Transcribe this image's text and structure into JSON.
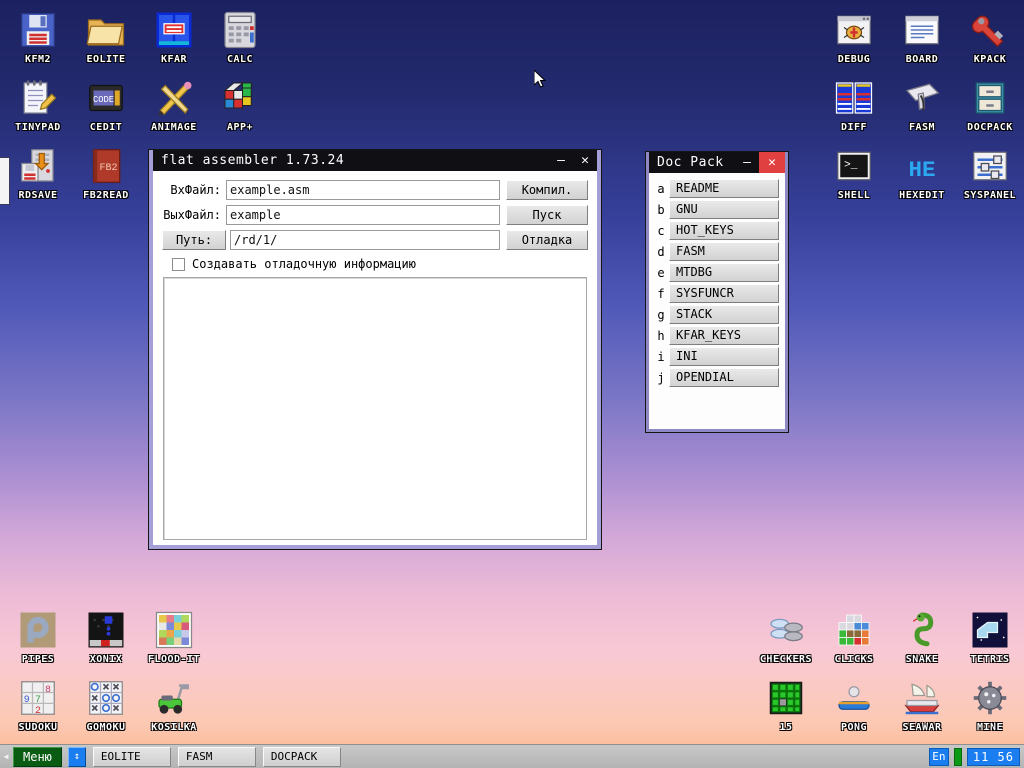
{
  "desktop": {
    "background_top": "#1b2160",
    "background_bottom": "#fbb489",
    "icons_top_left": [
      {
        "label": "KFM2",
        "icon": "floppy-disk-icon"
      },
      {
        "label": "EOLITE",
        "icon": "folder-icon"
      },
      {
        "label": "KFAR",
        "icon": "file-manager-icon"
      },
      {
        "label": "CALC",
        "icon": "calculator-icon"
      },
      {
        "label": "TINYPAD",
        "icon": "notepad-pencil-icon"
      },
      {
        "label": "CEDIT",
        "icon": "code-editor-icon"
      },
      {
        "label": "ANIMAGE",
        "icon": "pencil-brush-icon"
      },
      {
        "label": "APP+",
        "icon": "rubik-cube-icon"
      },
      {
        "label": "RDSAVE",
        "icon": "ramdisk-save-icon"
      },
      {
        "label": "FB2READ",
        "icon": "book-icon"
      }
    ],
    "icons_top_right": [
      {
        "label": "DEBUG",
        "icon": "bug-window-icon"
      },
      {
        "label": "BOARD",
        "icon": "text-window-icon"
      },
      {
        "label": "KPACK",
        "icon": "wrench-icon"
      },
      {
        "label": "DIFF",
        "icon": "diff-columns-icon"
      },
      {
        "label": "FASM",
        "icon": "assembler-hand-icon"
      },
      {
        "label": "DOCPACK",
        "icon": "cabinet-icon"
      },
      {
        "label": "SHELL",
        "icon": "terminal-icon"
      },
      {
        "label": "HEXEDIT",
        "icon": "hex-editor-icon"
      },
      {
        "label": "SYSPANEL",
        "icon": "sliders-icon"
      }
    ],
    "icons_bottom_left": [
      {
        "label": "PIPES",
        "icon": "pipes-icon"
      },
      {
        "label": "XONIX",
        "icon": "xonix-icon"
      },
      {
        "label": "FLOOD-IT",
        "icon": "flood-it-icon"
      },
      {
        "label": "SUDOKU",
        "icon": "sudoku-icon"
      },
      {
        "label": "GOMOKU",
        "icon": "gomoku-icon"
      },
      {
        "label": "KOSILKA",
        "icon": "lawnmower-icon"
      }
    ],
    "icons_bottom_right": [
      {
        "label": "CHECKERS",
        "icon": "checkers-icon"
      },
      {
        "label": "CLICKS",
        "icon": "blocks-icon"
      },
      {
        "label": "SNAKE",
        "icon": "snake-icon"
      },
      {
        "label": "TETRIS",
        "icon": "tetris-icon"
      },
      {
        "label": "15",
        "icon": "fifteen-puzzle-icon"
      },
      {
        "label": "PONG",
        "icon": "pong-icon"
      },
      {
        "label": "SEAWAR",
        "icon": "ship-icon"
      },
      {
        "label": "MINE",
        "icon": "mine-icon"
      }
    ]
  },
  "fasm_window": {
    "title": "flat assembler 1.73.24",
    "minimize_label": "–",
    "close_label": "✕",
    "input_file_label": "ВхФайл:",
    "input_file_value": "example.asm",
    "output_file_label": "ВыхФайл:",
    "output_file_value": "example",
    "path_button_label": "Путь:",
    "path_value": "/rd/1/",
    "compile_button_label": "Компил.",
    "run_button_label": "Пуск",
    "debug_button_label": "Отладка",
    "debug_checkbox_label": "Создавать отладочную информацию",
    "debug_checkbox_checked": false,
    "output_text": ""
  },
  "docpack_window": {
    "title": "Doc Pack",
    "minimize_label": "–",
    "close_label": "✕",
    "close_color": "#e04040",
    "items": [
      {
        "key": "a",
        "label": "README"
      },
      {
        "key": "b",
        "label": "GNU"
      },
      {
        "key": "c",
        "label": "HOT_KEYS"
      },
      {
        "key": "d",
        "label": "FASM"
      },
      {
        "key": "e",
        "label": "MTDBG"
      },
      {
        "key": "f",
        "label": "SYSFUNCR"
      },
      {
        "key": "g",
        "label": "STACK"
      },
      {
        "key": "h",
        "label": "KFAR_KEYS"
      },
      {
        "key": "i",
        "label": "INI"
      },
      {
        "key": "j",
        "label": "OPENDIAL"
      }
    ]
  },
  "taskbar": {
    "collapse_arrow": "◀",
    "menu_label": "Меню",
    "menu_color": "#0a5c12",
    "minimize_all_label": "↕",
    "tasks": [
      {
        "label": "EOLITE"
      },
      {
        "label": "FASM"
      },
      {
        "label": "DOCPACK"
      }
    ],
    "language": "En",
    "clock": "11 56",
    "accent_color": "#1a7ef0"
  }
}
